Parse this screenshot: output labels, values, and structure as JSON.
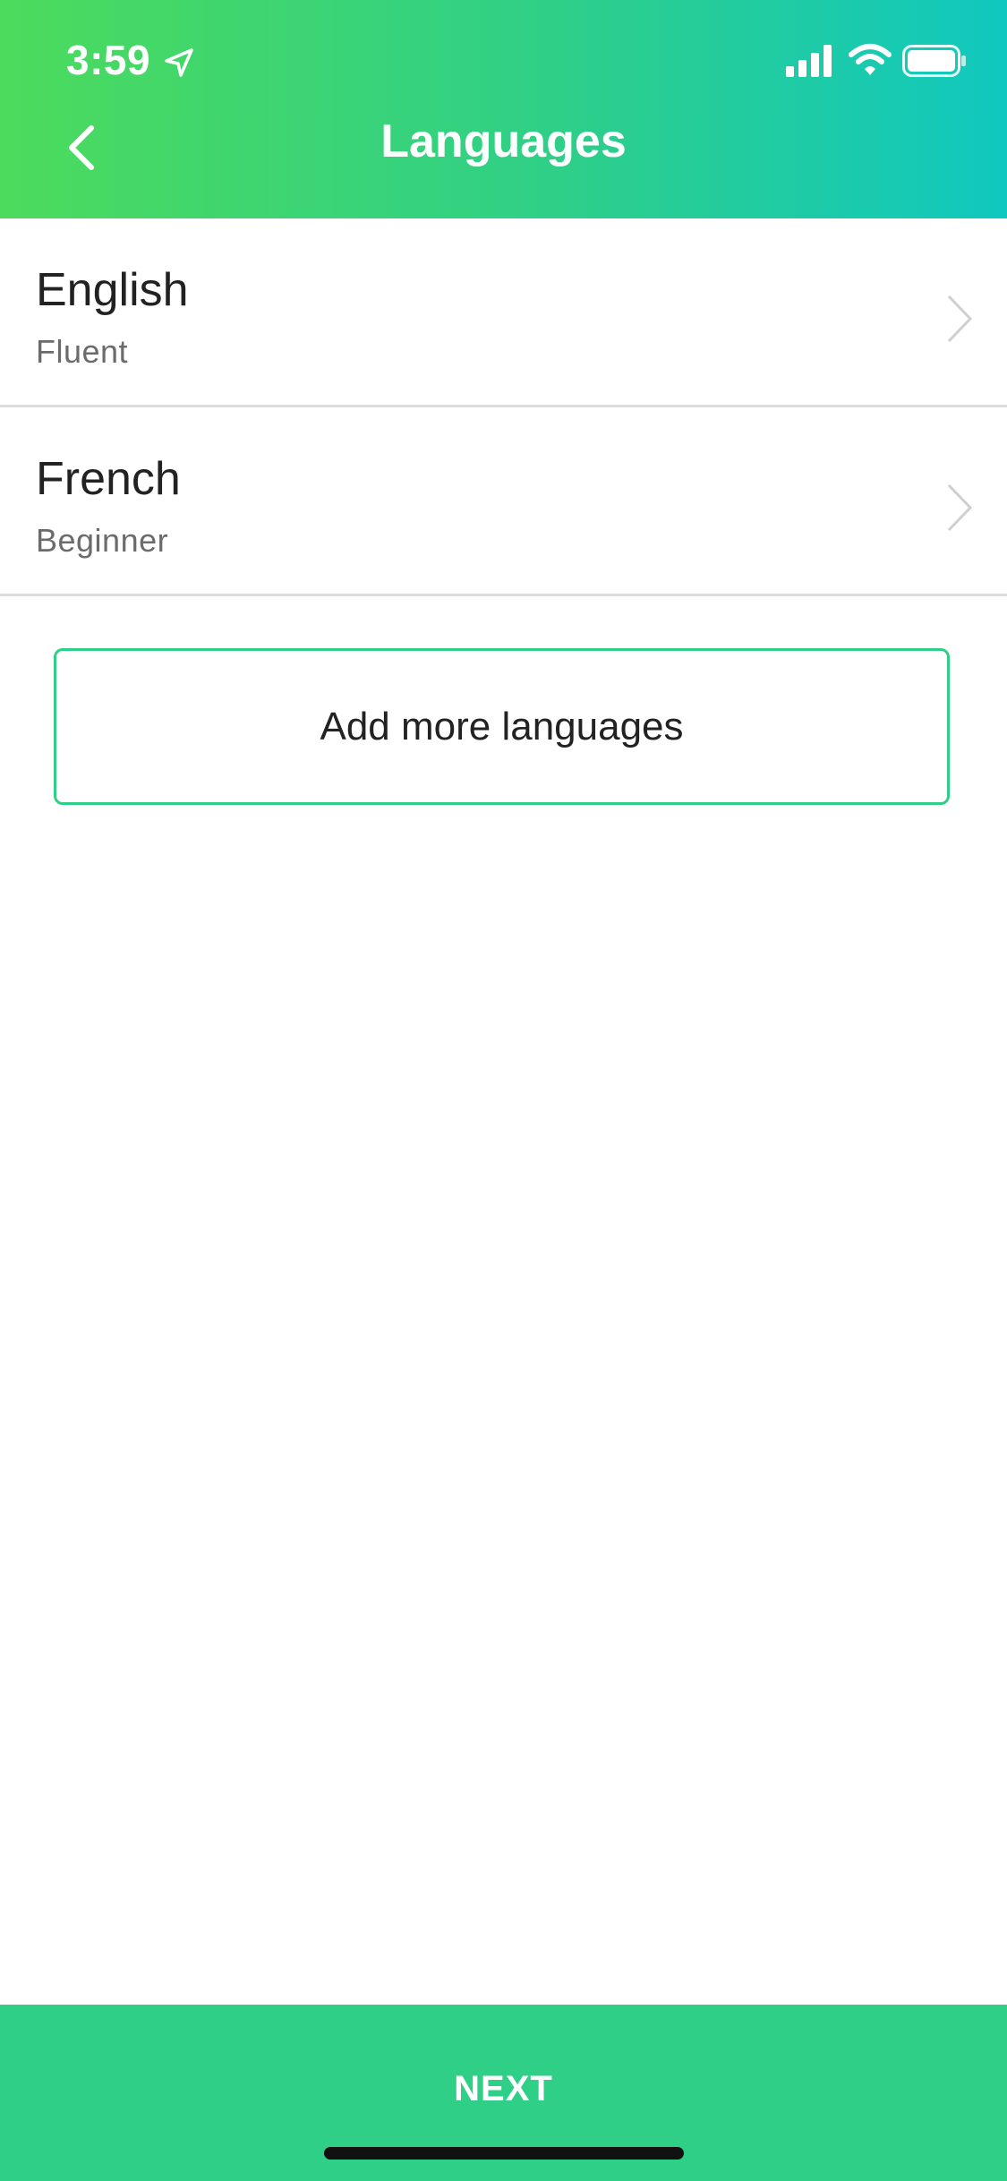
{
  "status_bar": {
    "time": "3:59",
    "icons": [
      "location-arrow-icon",
      "cellular-signal-icon",
      "wifi-icon",
      "battery-icon"
    ]
  },
  "header": {
    "title": "Languages",
    "back_icon": "chevron-left-icon"
  },
  "languages": [
    {
      "name": "English",
      "level": "Fluent"
    },
    {
      "name": "French",
      "level": "Beginner"
    }
  ],
  "add_button": {
    "label": "Add more languages"
  },
  "footer": {
    "next_label": "NEXT"
  },
  "colors": {
    "gradient_start": "#4cdb5c",
    "gradient_end": "#10c8bf",
    "accent_green": "#2fcf88",
    "divider": "#dcdcdc"
  }
}
